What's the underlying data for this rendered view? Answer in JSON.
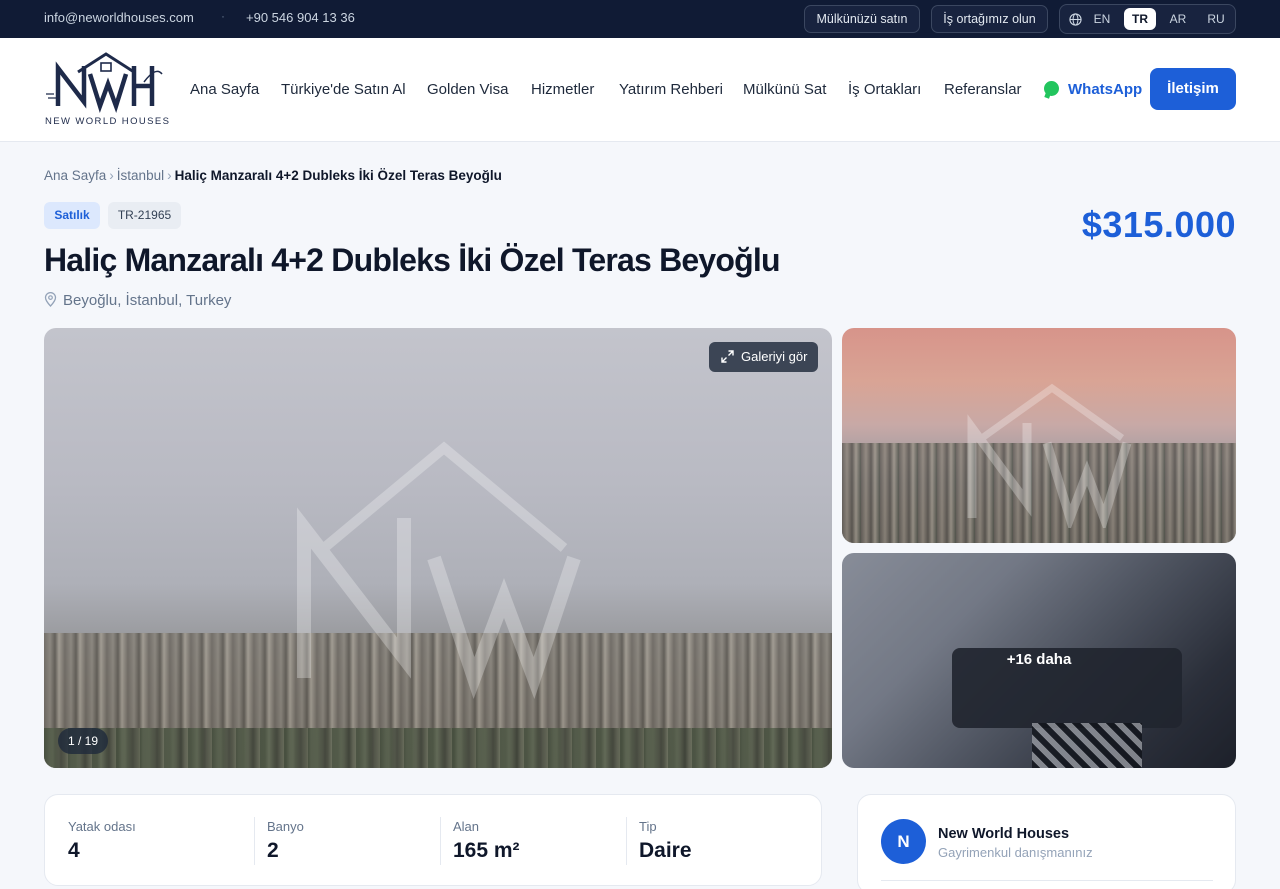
{
  "topbar": {
    "email": "info@neworldhouses.com",
    "separator": "·",
    "phone": "+90 546 904 13 36",
    "sell_button": "Mülkünüzü satın",
    "partner_button": "İş ortağımız olun",
    "languages": [
      {
        "code": "EN",
        "active": false
      },
      {
        "code": "TR",
        "active": true
      },
      {
        "code": "AR",
        "active": false
      },
      {
        "code": "RU",
        "active": false
      }
    ]
  },
  "header": {
    "logo_text": "NEW WORLD HOUSES",
    "nav": [
      "Ana Sayfa",
      "Türkiye'de Satın Al",
      "Golden Visa",
      "Hizmetler",
      "Yatırım Rehberi",
      "Mülkünü Sat",
      "İş Ortakları",
      "Referanslar"
    ],
    "whatsapp": "WhatsApp",
    "contact_button": "İletişim"
  },
  "breadcrumb": {
    "items": [
      "Ana Sayfa",
      "İstanbul"
    ],
    "separator": "›",
    "current": "Haliç Manzaralı 4+2 Dubleks İki Özel Teras Beyoğlu"
  },
  "listing": {
    "status_badge": "Satılık",
    "ref_code": "TR-21965",
    "title": "Haliç Manzaralı 4+2 Dubleks İki Özel Teras Beyoğlu",
    "price": "$315.000",
    "location": "Beyoğlu, İstanbul, Turkey"
  },
  "gallery": {
    "view_gallery": "Galeriyi gör",
    "counter": "1 / 19",
    "more_label": "+16 daha",
    "watermark_text": "NEW WORLD HOUSES"
  },
  "specs": [
    {
      "label": "Yatak odası",
      "value": "4"
    },
    {
      "label": "Banyo",
      "value": "2"
    },
    {
      "label": "Alan",
      "value": "165 m²"
    },
    {
      "label": "Tip",
      "value": "Daire"
    }
  ],
  "agent": {
    "initial": "N",
    "name": "New World Houses",
    "role": "Gayrimenkul danışmanınız"
  },
  "colors": {
    "primary": "#1d5fd8",
    "topbar_bg": "#101b35",
    "whatsapp_green": "#22c55e",
    "page_bg": "#f5f7fb"
  },
  "icons": [
    "globe-icon",
    "whatsapp-icon",
    "map-pin-icon",
    "expand-icon",
    "logo-house-icon"
  ]
}
